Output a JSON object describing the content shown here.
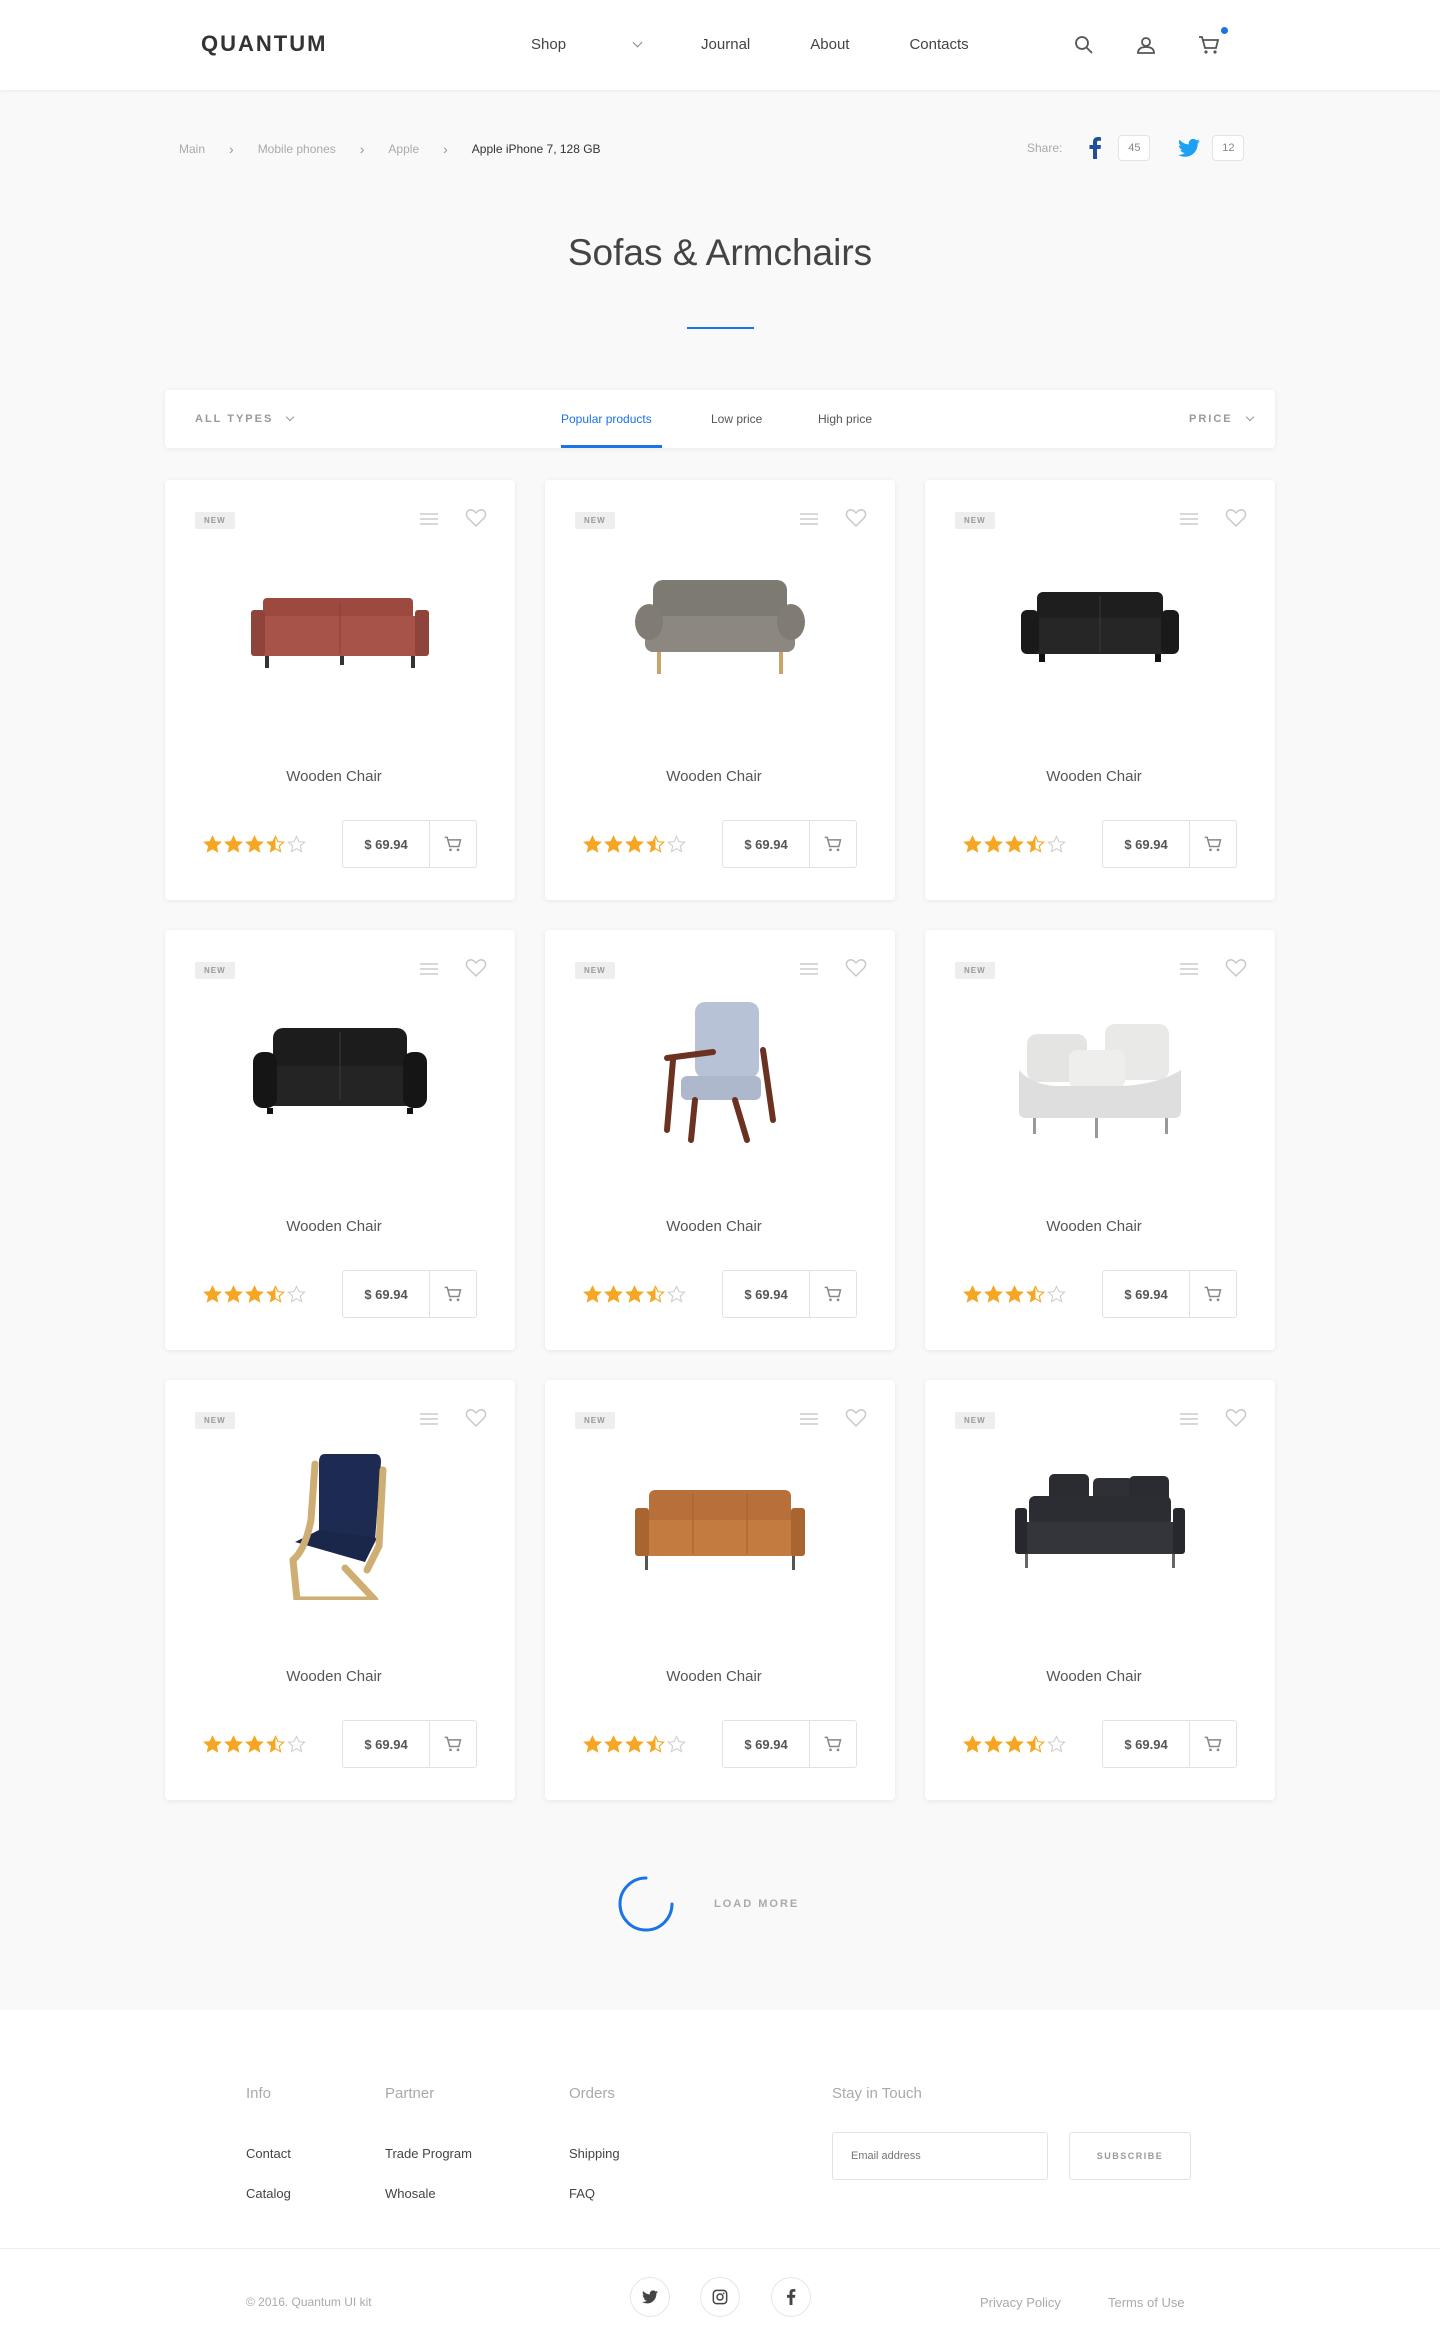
{
  "header": {
    "logo": "QUANTUM",
    "nav": [
      {
        "label": "Shop"
      },
      {
        "label": "Journal"
      },
      {
        "label": "About"
      },
      {
        "label": "Contacts"
      }
    ],
    "icons": [
      "search-icon",
      "user-icon",
      "cart-icon"
    ],
    "accent": "#1b73e8"
  },
  "breadcrumb": {
    "items": [
      "Main",
      "Mobile phones",
      "Apple"
    ],
    "current": "Apple iPhone 7, 128 GB"
  },
  "share": {
    "label": "Share:",
    "facebook_count": "45",
    "twitter_count": "12"
  },
  "page": {
    "title": "Sofas & Armchairs"
  },
  "filter": {
    "types_label": "ALL TYPES",
    "tabs": [
      "Popular products",
      "Low price",
      "High price"
    ],
    "active_tab": "Popular products",
    "price_label": "PRICE"
  },
  "products": [
    {
      "badge": "NEW",
      "name": "Wooden Chair",
      "price": "$ 69.94",
      "rating": 3.5,
      "image": "sofa-red"
    },
    {
      "badge": "NEW",
      "name": "Wooden Chair",
      "price": "$ 69.94",
      "rating": 3.5,
      "image": "sofa-grey"
    },
    {
      "badge": "NEW",
      "name": "Wooden Chair",
      "price": "$ 69.94",
      "rating": 3.5,
      "image": "sofa-black-modern"
    },
    {
      "badge": "NEW",
      "name": "Wooden Chair",
      "price": "$ 69.94",
      "rating": 3.5,
      "image": "sofa-black-leather"
    },
    {
      "badge": "NEW",
      "name": "Wooden Chair",
      "price": "$ 69.94",
      "rating": 3.5,
      "image": "armchair-wood"
    },
    {
      "badge": "NEW",
      "name": "Wooden Chair",
      "price": "$ 69.94",
      "rating": 3.5,
      "image": "corner-white"
    },
    {
      "badge": "NEW",
      "name": "Wooden Chair",
      "price": "$ 69.94",
      "rating": 3.5,
      "image": "chair-navy"
    },
    {
      "badge": "NEW",
      "name": "Wooden Chair",
      "price": "$ 69.94",
      "rating": 3.5,
      "image": "sofa-tan"
    },
    {
      "badge": "NEW",
      "name": "Wooden Chair",
      "price": "$ 69.94",
      "rating": 3.5,
      "image": "sofa-dark"
    }
  ],
  "load_more": "LOAD MORE",
  "footer": {
    "columns": [
      {
        "title": "Info",
        "links": [
          "Contact",
          "Catalog"
        ]
      },
      {
        "title": "Partner",
        "links": [
          "Trade Program",
          "Whosale"
        ]
      },
      {
        "title": "Orders",
        "links": [
          "Shipping",
          "FAQ"
        ]
      }
    ],
    "newsletter_title": "Stay in Touch",
    "email_placeholder": "Email address",
    "subscribe_label": "SUBSCRIBE",
    "copyright": "© 2016. Quantum UI kit",
    "social": [
      "twitter-icon",
      "instagram-icon",
      "facebook-icon"
    ],
    "privacy": "Privacy Policy",
    "terms": "Terms of Use"
  },
  "colors": {
    "accent": "#1b73e8",
    "star": "#f5a623",
    "star_empty": "#d0d0d0"
  }
}
